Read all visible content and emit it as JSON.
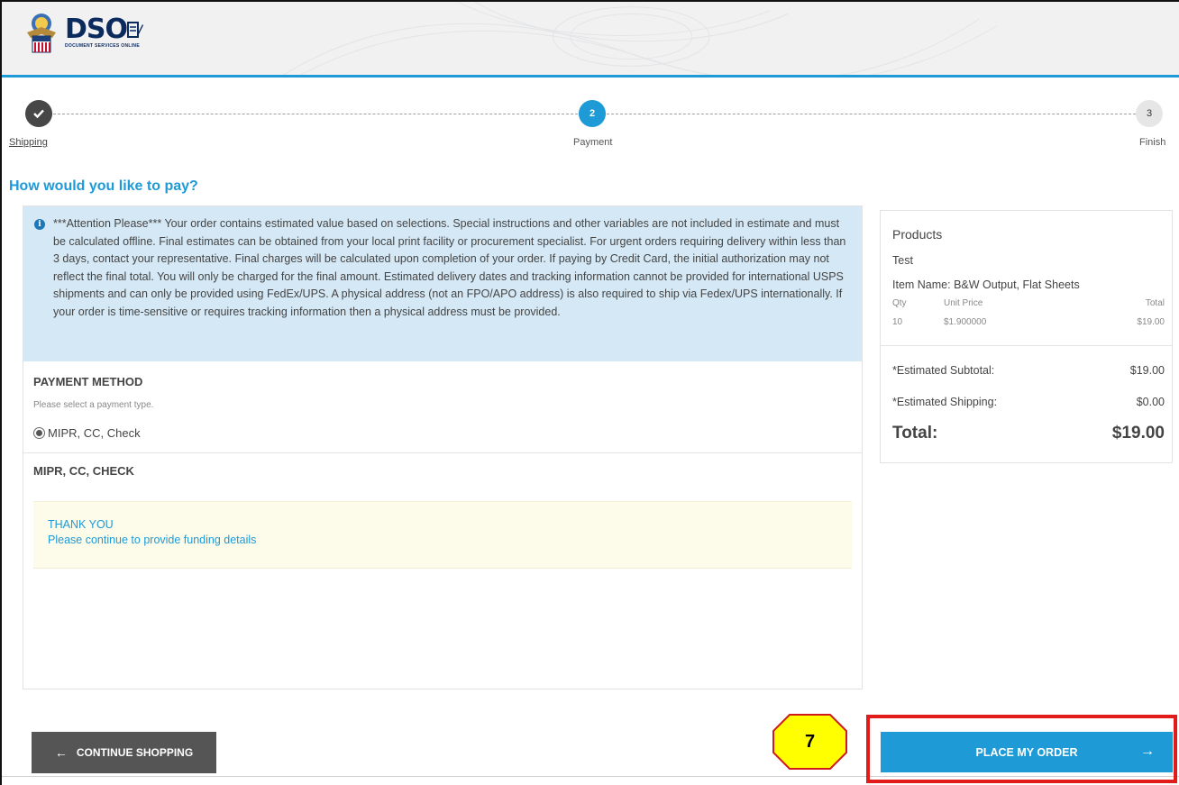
{
  "header": {
    "logo_text": "DSO",
    "logo_subtitle": "DOCUMENT SERVICES ONLINE"
  },
  "steps": [
    {
      "number": "✓",
      "label": "Shipping",
      "state": "complete"
    },
    {
      "number": "2",
      "label": "Payment",
      "state": "active"
    },
    {
      "number": "3",
      "label": "Finish",
      "state": "pending"
    }
  ],
  "page_title": "How would you like to pay?",
  "notice": {
    "icon": "info-icon",
    "text": "***Attention Please*** Your order contains estimated value based on selections. Special instructions and other variables are not included in estimate and must be calculated offline. Final estimates can be obtained from your local print facility or procurement specialist. For urgent orders requiring delivery within less than 3 days, contact your representative. Final charges will be calculated upon completion of your order. If paying by Credit Card, the initial authorization may not reflect the final total. You will only be charged for the final amount. Estimated delivery dates and tracking information cannot be provided for international USPS shipments and can only be provided using FedEx/UPS. A physical address (not an FPO/APO address) is also required to ship via Fedex/UPS internationally. If your order is time-sensitive or requires tracking information then a physical address must be provided."
  },
  "payment": {
    "title": "PAYMENT METHOD",
    "subtitle": "Please select a payment type.",
    "option_label": "MIPR, CC, Check",
    "option_selected": true,
    "section_title": "MIPR, CC, CHECK",
    "thanks_title": "THANK YOU",
    "thanks_message": "Please continue to provide funding details"
  },
  "summary": {
    "products_label": "Products",
    "product_name": "Test",
    "item_name": "Item Name: B&W Output, Flat Sheets",
    "col_qty": "Qty",
    "col_unit_price": "Unit Price",
    "col_total": "Total",
    "qty": "10",
    "unit_price": "$1.900000",
    "line_total": "$19.00",
    "subtotal_label": "*Estimated Subtotal:",
    "subtotal_value": "$19.00",
    "shipping_label": "*Estimated Shipping:",
    "shipping_value": "$0.00",
    "total_label": "Total:",
    "total_value": "$19.00"
  },
  "buttons": {
    "continue_label": "CONTINUE SHOPPING",
    "place_label": "PLACE MY ORDER"
  },
  "annotation": {
    "callout_number": "7",
    "highlight_color": "#e21b1b",
    "callout_fill": "#ffff00"
  },
  "colors": {
    "accent": "#1e9ad6",
    "notice_bg": "#d5e8f5",
    "dark_button": "#555555"
  }
}
